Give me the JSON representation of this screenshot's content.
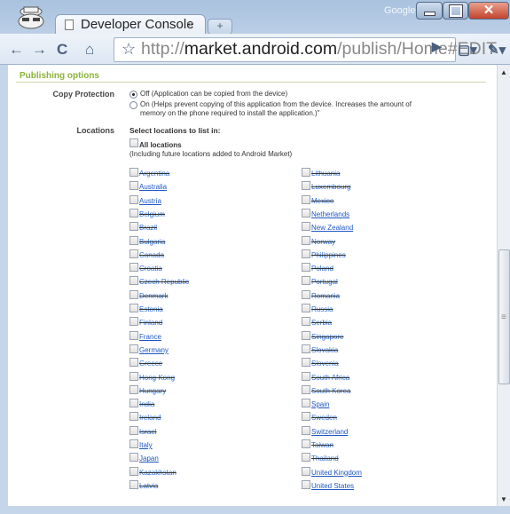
{
  "browser": {
    "tab_title": "Developer Console",
    "tab_close": "×",
    "new_tab": "+",
    "google_label": "Google",
    "url_host": "market.android.com",
    "url_prefix": "http://",
    "url_path": "/publish/Home#EDIT",
    "icons": [
      "incognito-icon",
      "back-icon",
      "forward-icon",
      "reload-icon",
      "home-icon",
      "star-icon",
      "go-icon",
      "page-menu-icon",
      "wrench-icon"
    ]
  },
  "page": {
    "section_title": "Publishing options",
    "copy_protection": {
      "label": "Copy Protection",
      "off_text": "Off (Application can be copied from the device)",
      "on_text_1": "On (Helps prevent copying of this application from the device. Increases the amount of",
      "on_text_2": "memory on the phone required to install the application.)\"",
      "selected": "Off"
    },
    "locations": {
      "label": "Locations",
      "heading": "Select locations to list in:",
      "all_label": "All locations",
      "all_note": "(Including future locations added to Android Market)",
      "left": [
        {
          "name": "Argentina",
          "available": false
        },
        {
          "name": "Australia",
          "available": true
        },
        {
          "name": "Austria",
          "available": true
        },
        {
          "name": "Belgium",
          "available": false
        },
        {
          "name": "Brazil",
          "available": false
        },
        {
          "name": "Bulgaria",
          "available": false
        },
        {
          "name": "Canada",
          "available": false
        },
        {
          "name": "Croatia",
          "available": false
        },
        {
          "name": "Czech Republic",
          "available": false
        },
        {
          "name": "Denmark",
          "available": false
        },
        {
          "name": "Estonia",
          "available": false
        },
        {
          "name": "Finland",
          "available": false
        },
        {
          "name": "France",
          "available": true
        },
        {
          "name": "Germany",
          "available": true
        },
        {
          "name": "Greece",
          "available": false
        },
        {
          "name": "Hong Kong",
          "available": false
        },
        {
          "name": "Hungary",
          "available": false
        },
        {
          "name": "India",
          "available": false
        },
        {
          "name": "Ireland",
          "available": false
        },
        {
          "name": "Israel",
          "available": false
        },
        {
          "name": "Italy",
          "available": true
        },
        {
          "name": "Japan",
          "available": true
        },
        {
          "name": "Kazakhstan",
          "available": false
        },
        {
          "name": "Latvia",
          "available": false
        }
      ],
      "right": [
        {
          "name": "Lithuania",
          "available": false
        },
        {
          "name": "Luxembourg",
          "available": false
        },
        {
          "name": "Mexico",
          "available": false
        },
        {
          "name": "Netherlands",
          "available": true
        },
        {
          "name": "New Zealand",
          "available": true
        },
        {
          "name": "Norway",
          "available": false
        },
        {
          "name": "Philippines",
          "available": false
        },
        {
          "name": "Poland",
          "available": false
        },
        {
          "name": "Portugal",
          "available": false
        },
        {
          "name": "Romania",
          "available": false
        },
        {
          "name": "Russia",
          "available": false
        },
        {
          "name": "Serbia",
          "available": false
        },
        {
          "name": "Singapore",
          "available": false
        },
        {
          "name": "Slovakia",
          "available": false
        },
        {
          "name": "Slovenia",
          "available": false
        },
        {
          "name": "South Africa",
          "available": false
        },
        {
          "name": "South Korea",
          "available": false
        },
        {
          "name": "Spain",
          "available": true
        },
        {
          "name": "Sweden",
          "available": false
        },
        {
          "name": "Switzerland",
          "available": true
        },
        {
          "name": "Taiwan",
          "available": false
        },
        {
          "name": "Thailand",
          "available": false
        },
        {
          "name": "United Kingdom",
          "available": true
        },
        {
          "name": "United States",
          "available": true
        }
      ]
    }
  }
}
